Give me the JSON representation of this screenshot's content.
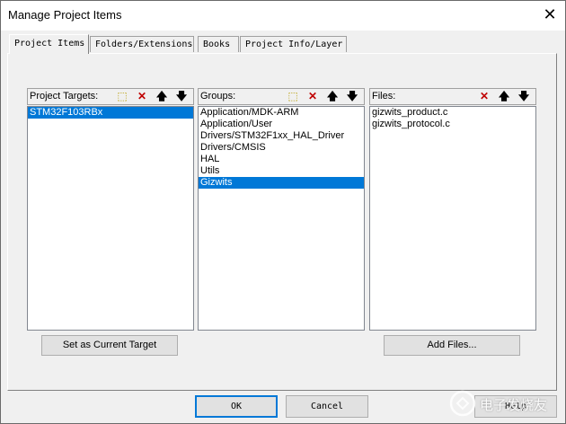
{
  "window": {
    "title": "Manage Project Items",
    "close_glyph": "✕"
  },
  "tabs": [
    {
      "label": "Project Items",
      "active": true
    },
    {
      "label": "Folders/Extensions",
      "active": false
    },
    {
      "label": "Books",
      "active": false
    },
    {
      "label": "Project Info/Layer",
      "active": false
    }
  ],
  "targets": {
    "label": "Project Targets:",
    "items": [
      "STM32F103RBx"
    ],
    "selected_index": 0,
    "button_label": "Set as Current Target"
  },
  "groups": {
    "label": "Groups:",
    "items": [
      "Application/MDK-ARM",
      "Application/User",
      "Drivers/STM32F1xx_HAL_Driver",
      "Drivers/CMSIS",
      "HAL",
      "Utils",
      "Gizwits"
    ],
    "selected_index": 6
  },
  "files": {
    "label": "Files:",
    "items": [
      "gizwits_product.c",
      "gizwits_protocol.c"
    ],
    "button_label": "Add Files..."
  },
  "toolbar_glyphs": {
    "new": "⬚",
    "delete": "✕",
    "up": "🡅",
    "down": "🡇"
  },
  "dialog_buttons": {
    "ok": "OK",
    "cancel": "Cancel",
    "help": "Help"
  },
  "watermark": {
    "text": "电子发烧友"
  },
  "colors": {
    "selection": "#0078d7",
    "delete_icon": "#c00000",
    "default_button_border": "#0078d7"
  }
}
